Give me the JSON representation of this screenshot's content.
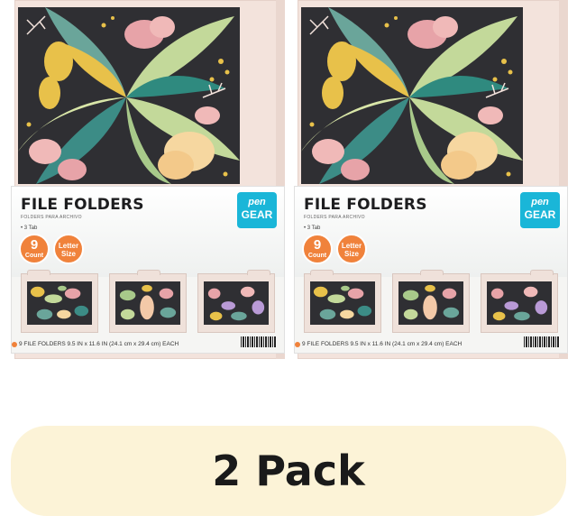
{
  "products": [
    {
      "title": "FILE FOLDERS",
      "subtitle": "FOLDERS PARA ARCHIVO",
      "tab_note": "• 3 Tab",
      "brand": {
        "line1": "pen",
        "line2": "GEAR"
      },
      "badge_count": {
        "number": "9",
        "text": "Count"
      },
      "badge_size": {
        "text": "Letter Size"
      },
      "footer": "9 FILE FOLDERS 9.5 IN x 11.6 IN (24.1 cm x 29.4 cm) EACH"
    },
    {
      "title": "FILE FOLDERS",
      "subtitle": "FOLDERS PARA ARCHIVO",
      "tab_note": "• 3 Tab",
      "brand": {
        "line1": "pen",
        "line2": "GEAR"
      },
      "badge_count": {
        "number": "9",
        "text": "Count"
      },
      "badge_size": {
        "text": "Letter Size"
      },
      "footer": "9 FILE FOLDERS 9.5 IN x 11.6 IN (24.1 cm x 29.4 cm) EACH"
    }
  ],
  "pack_label": "2 Pack",
  "colors": {
    "accent_orange": "#f0823b",
    "brand_blue": "#1ab6d8",
    "pill_bg": "#fcf3d7",
    "art_bg": "#2f2f33"
  }
}
